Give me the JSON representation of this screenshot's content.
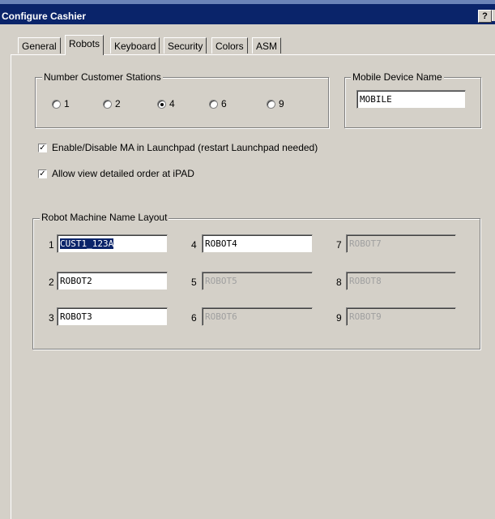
{
  "window": {
    "title": "Configure Cashier",
    "help_label": "?"
  },
  "tabs": [
    {
      "label": "General",
      "active": false
    },
    {
      "label": "Robots",
      "active": true
    },
    {
      "label": "Keyboard",
      "active": false
    },
    {
      "label": "Security",
      "active": false
    },
    {
      "label": "Colors",
      "active": false
    },
    {
      "label": "ASM",
      "active": false
    }
  ],
  "customer_stations": {
    "legend": "Number Customer Stations",
    "options": [
      "1",
      "2",
      "4",
      "6",
      "9"
    ],
    "selected": "4"
  },
  "mobile_device": {
    "legend": "Mobile Device Name",
    "value": "MOBILE"
  },
  "checkboxes": [
    {
      "label": "Enable/Disable MA in Launchpad (restart Launchpad needed)",
      "checked": true
    },
    {
      "label": "Allow view detailed order at iPAD",
      "checked": true
    }
  ],
  "robot_layout": {
    "legend": "Robot Machine Name Layout",
    "robots": [
      {
        "num": "1",
        "value": "CUST1_123A",
        "enabled": true,
        "selected": true
      },
      {
        "num": "2",
        "value": "ROBOT2",
        "enabled": true
      },
      {
        "num": "3",
        "value": "ROBOT3",
        "enabled": true
      },
      {
        "num": "4",
        "value": "ROBOT4",
        "enabled": true
      },
      {
        "num": "5",
        "value": "ROBOT5",
        "enabled": false
      },
      {
        "num": "6",
        "value": "ROBOT6",
        "enabled": false
      },
      {
        "num": "7",
        "value": "ROBOT7",
        "enabled": false
      },
      {
        "num": "8",
        "value": "ROBOT8",
        "enabled": false
      },
      {
        "num": "9",
        "value": "ROBOT9",
        "enabled": false
      }
    ]
  }
}
